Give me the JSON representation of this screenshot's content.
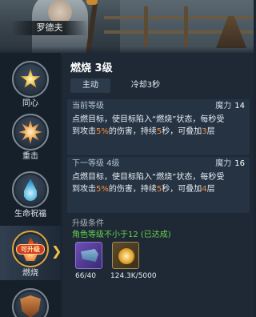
{
  "character": {
    "name": "罗德夫"
  },
  "skills": [
    {
      "label": "同心",
      "icon": "gold-star-icon"
    },
    {
      "label": "重击",
      "icon": "burst-icon"
    },
    {
      "label": "生命祝福",
      "icon": "water-drop-icon"
    },
    {
      "label": "燃烧",
      "icon": "flame-icon",
      "badge": "可升级",
      "selected": true
    },
    {
      "label": "",
      "icon": "shield-icon"
    }
  ],
  "detail": {
    "title": "燃烧 3级",
    "type": "主动",
    "cooldown": "冷却3秒",
    "current": {
      "header": "当前等级",
      "power_label": "魔力",
      "power_value": "14",
      "desc_1": "点燃目标，使目标陷入“燃烧”状态，每秒受",
      "desc_2a": "到攻击",
      "desc_2b": "5%",
      "desc_2c": "的伤害，持续",
      "desc_2d": "5",
      "desc_2e": "秒，可叠加",
      "desc_2f": "3",
      "desc_2g": "层"
    },
    "next": {
      "header": "下一等级 4级",
      "power_label": "魔力",
      "power_value": "16",
      "desc_1": "点燃目标，使目标陷入“燃烧”状态，每秒受",
      "desc_2a": "到攻击",
      "desc_2b": "5%",
      "desc_2c": "的伤害，持续",
      "desc_2d": "5",
      "desc_2e": "秒，可叠加",
      "desc_2f": "4",
      "desc_2g": "层"
    },
    "requirements": {
      "title": "升级条件",
      "condition": "角色等级不小于12 (已达成)",
      "items": [
        {
          "icon": "flag-scroll-icon",
          "amount": "66/40"
        },
        {
          "icon": "gold-coin-icon",
          "amount": "124.3K/5000"
        }
      ]
    }
  },
  "colors": {
    "highlight": "#ff8d3a",
    "condition_met": "#66d04c",
    "badge": "#d13a2a"
  }
}
